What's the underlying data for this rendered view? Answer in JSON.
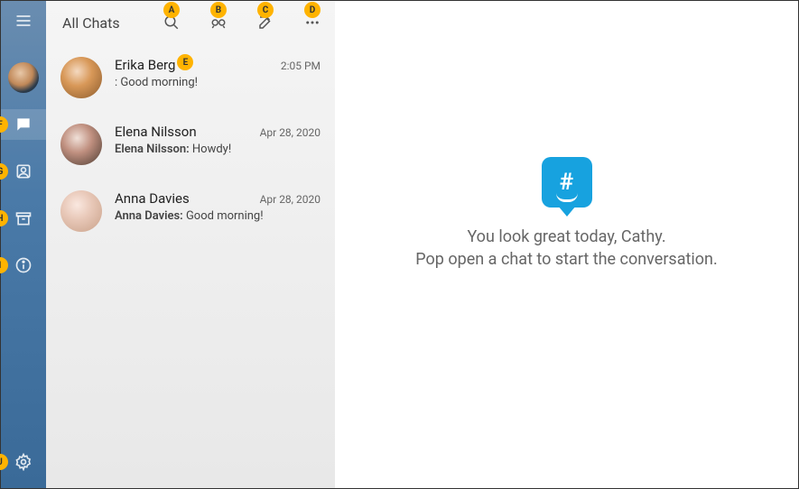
{
  "callouts": {
    "a": "A",
    "b": "B",
    "c": "C",
    "d": "D",
    "e": "E",
    "f": "F",
    "g": "G",
    "h": "H",
    "i": "I",
    "j": "J"
  },
  "header": {
    "title": "All Chats"
  },
  "chats": [
    {
      "name": "Erika Berg",
      "time": "2:05 PM",
      "sender": "",
      "message": ": Good morning!"
    },
    {
      "name": "Elena Nilsson",
      "time": "Apr 28, 2020",
      "sender": "Elena Nilsson: ",
      "message": "Howdy!"
    },
    {
      "name": "Anna Davies",
      "time": "Apr 28, 2020",
      "sender": "Anna Davies: ",
      "message": "Good morning!"
    }
  ],
  "main": {
    "logo_mark": "#",
    "line1": "You look great today, Cathy.",
    "line2": "Pop open a chat to start the conversation."
  }
}
